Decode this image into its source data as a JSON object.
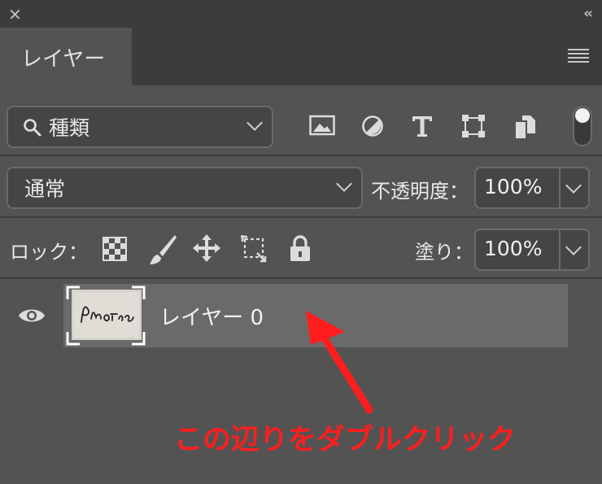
{
  "window": {
    "close_glyph": "✕",
    "collapse_glyph": "‹‹"
  },
  "panel": {
    "tab_label": "レイヤー",
    "menu_icon": "hamburger-icon"
  },
  "filter": {
    "kind_label": "種類",
    "icons": [
      "image-filter-icon",
      "adjustment-filter-icon",
      "type-filter-icon",
      "shape-filter-icon",
      "smart-object-filter-icon"
    ],
    "toggle_on": true
  },
  "blend": {
    "mode": "通常",
    "opacity_label": "不透明度：",
    "opacity_value": "100%"
  },
  "lock": {
    "label": "ロック：",
    "fill_label": "塗り：",
    "fill_value": "100%",
    "icons": [
      "lock-transparent-pixels-icon",
      "lock-image-pixels-icon",
      "lock-position-icon",
      "artboard-autonest-icon",
      "lock-all-icon"
    ]
  },
  "layers": [
    {
      "name": "レイヤー 0",
      "visible": true,
      "thumb_text": "Photoshop"
    }
  ],
  "annotation": {
    "text": "この辺りをダブルクリック",
    "color": "#ff1e1e"
  }
}
